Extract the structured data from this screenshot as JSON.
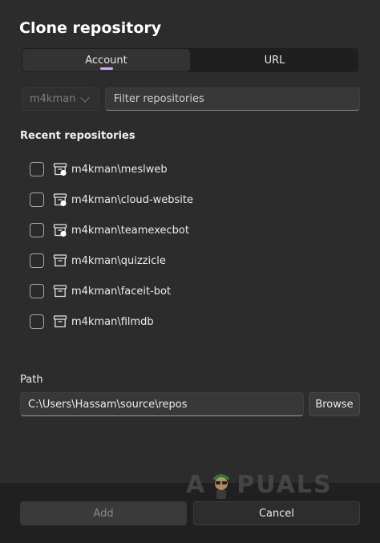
{
  "dialog": {
    "title": "Clone repository"
  },
  "tabs": [
    {
      "label": "Account",
      "active": true
    },
    {
      "label": "URL",
      "active": false
    }
  ],
  "account": {
    "selected": "m4kman"
  },
  "filter": {
    "placeholder": "Filter repositories",
    "value": ""
  },
  "recent": {
    "label": "Recent repositories",
    "items": [
      {
        "name": "m4kman\\meslweb",
        "icon": "repo-private-icon",
        "checked": false
      },
      {
        "name": "m4kman\\cloud-website",
        "icon": "repo-private-icon",
        "checked": false
      },
      {
        "name": "m4kman\\teamexecbot",
        "icon": "repo-private-icon",
        "checked": false
      },
      {
        "name": "m4kman\\quizzicle",
        "icon": "repo-icon",
        "checked": false
      },
      {
        "name": "m4kman\\faceit-bot",
        "icon": "repo-icon",
        "checked": false
      },
      {
        "name": "m4kman\\filmdb",
        "icon": "repo-icon",
        "checked": false
      }
    ]
  },
  "path": {
    "label": "Path",
    "value": "C:\\Users\\Hassam\\source\\repos",
    "browse_label": "Browse"
  },
  "footer": {
    "add_label": "Add",
    "cancel_label": "Cancel"
  },
  "watermark": {
    "text_left": "A",
    "text_right": "PUALS"
  },
  "colors": {
    "accent": "#d9a6ff",
    "background": "#2c2c2c",
    "footer": "#202020"
  }
}
